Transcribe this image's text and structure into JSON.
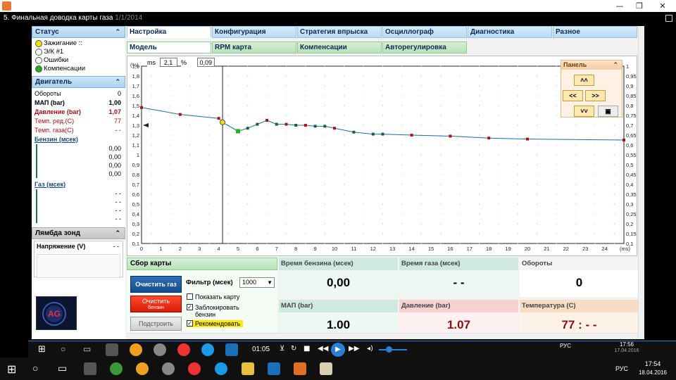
{
  "player": {
    "title_icon": "player-app-icon",
    "time": "01:05"
  },
  "video": {
    "window_title": "5. Финальная доводка карты газа",
    "window_title_ghost": "1/1/2014"
  },
  "status": {
    "title": "Статус",
    "items": [
      {
        "label": "Зажигание ::",
        "color": "#f2e200"
      },
      {
        "label": "Э/К #1",
        "color": "#ffffff"
      },
      {
        "label": "Ошибки",
        "color": "#ffffff"
      },
      {
        "label": "Компенсации",
        "color": "#20b020"
      }
    ]
  },
  "engine": {
    "title": "Двигатель",
    "rows": [
      {
        "label": "Обороты",
        "value": "0"
      },
      {
        "label": "МАП (bar)",
        "value": "1,00"
      },
      {
        "label": "Давление (bar)",
        "value": "1,07"
      },
      {
        "label": "Темп. ред.(C)",
        "value": "77"
      },
      {
        "label": "Темп. газа(C)",
        "value": "- -"
      }
    ],
    "petrol_link": "Бензин (мсек)",
    "petrol_values": [
      "0,00",
      "0,00",
      "0,00",
      "0,00"
    ],
    "gas_link": "Газ (мсек)",
    "gas_values": [
      "- -",
      "- -",
      "- -",
      "- -"
    ]
  },
  "lambda": {
    "title": "Лямбда зонд",
    "voltage_label": "Напряжение (V)",
    "voltage_value": "- -"
  },
  "tabs_top": [
    "Настройка",
    "Конфигурация",
    "Стратегия впрыска",
    "Осциллограф",
    "Диагностика",
    "Разное"
  ],
  "tabs_sub": [
    "Модель",
    "RPM карта",
    "Компенсации",
    "Авторегулировка"
  ],
  "readout": {
    "ms_label": "ms",
    "ms_value": "2,1",
    "pct_label": "%",
    "pct_value": "0,09"
  },
  "panel": {
    "title": "Панель",
    "btn_up": "˄˄",
    "btn_left": "<<",
    "btn_right": ">>",
    "btn_down": "˅˅"
  },
  "chart_data": {
    "type": "line",
    "y_unit": "(%)",
    "x_unit": "(ms)",
    "xlim": [
      0,
      25
    ],
    "ylim": [
      0.1,
      1.9
    ],
    "x_ticks": [
      0,
      1,
      2,
      3,
      4,
      5,
      6,
      7,
      8,
      9,
      10,
      11,
      12,
      13,
      14,
      15,
      16,
      17,
      18,
      19,
      20,
      21,
      22,
      23,
      24
    ],
    "y_ticks_left": [
      "0,1",
      "0,2",
      "0,3",
      "0,4",
      "0,5",
      "0,6",
      "0,7",
      "0,8",
      "0,9",
      "1",
      "1,1",
      "1,2",
      "1,3",
      "1,4",
      "1,5",
      "1,6",
      "1,7",
      "1,8",
      "1,9"
    ],
    "y_ticks_right": [
      "0,1",
      "0,15",
      "0,2",
      "0,25",
      "0,3",
      "0,35",
      "0,4",
      "0,45",
      "0,5",
      "0,55",
      "0,6",
      "0,65",
      "0,7",
      "0,75",
      "0,8",
      "0,85",
      "0,9",
      "0,95",
      "1"
    ],
    "cursor_x": 4.2,
    "grid": true,
    "series": [
      {
        "color": "#1a6fa0",
        "x": [
          0,
          2,
          4,
          4.2,
          5,
          5.5,
          6,
          6.5,
          7,
          7.5,
          8,
          8.5,
          9,
          9.5,
          10,
          11,
          12,
          12.5,
          14,
          16,
          18,
          20,
          25
        ],
        "y": [
          1.48,
          1.41,
          1.37,
          1.33,
          1.24,
          1.27,
          1.31,
          1.35,
          1.31,
          1.31,
          1.3,
          1.3,
          1.29,
          1.29,
          1.27,
          1.23,
          1.21,
          1.21,
          1.2,
          1.19,
          1.17,
          1.16,
          1.15
        ],
        "marker_colors": [
          "#b01010",
          "#b01010",
          "#b01010",
          "#f2e200",
          "#20b020",
          "#1a6040",
          "#1a6040",
          "#b01010",
          "#1a6040",
          "#b01010",
          "#1a6040",
          "#b01010",
          "#1a6040",
          "#1a6040",
          "#b01010",
          "#1a6040",
          "#1a6040",
          "#1a6040",
          "#b01010",
          "#b01010",
          "#b01010",
          "#b01010",
          "#b01010"
        ]
      }
    ]
  },
  "collect": {
    "title": "Сбор карты",
    "clear_gas": "Очистить газ",
    "clear_petrol_1": "Очистить",
    "clear_petrol_2": "бензин",
    "build": "Подстроить",
    "filter_label": "Фильтр (мсек)",
    "filter_value": "1000",
    "show_map": "Показать карту",
    "block_petrol_1": "Заблокировать",
    "block_petrol_2": "бензин",
    "recommend": "Рекомендовать"
  },
  "metrics": [
    {
      "label": "Время бензина (мсек)",
      "value": "0,00"
    },
    {
      "label": "Время газа (мсек)",
      "value": "- -"
    },
    {
      "label": "Обороты",
      "value": "0"
    },
    {
      "label": "МАП (bar)",
      "value": "1.00"
    },
    {
      "label": "Давление (bar)",
      "value": "1.07"
    },
    {
      "label": "Температура (C)",
      "value": "77 :  - -"
    }
  ],
  "inner_tray": {
    "lang": "РУС",
    "time": "17:56",
    "date": "17.04.2016"
  },
  "tray": {
    "lang": "РУС",
    "time": "17:54",
    "date": "18.04.2016"
  }
}
